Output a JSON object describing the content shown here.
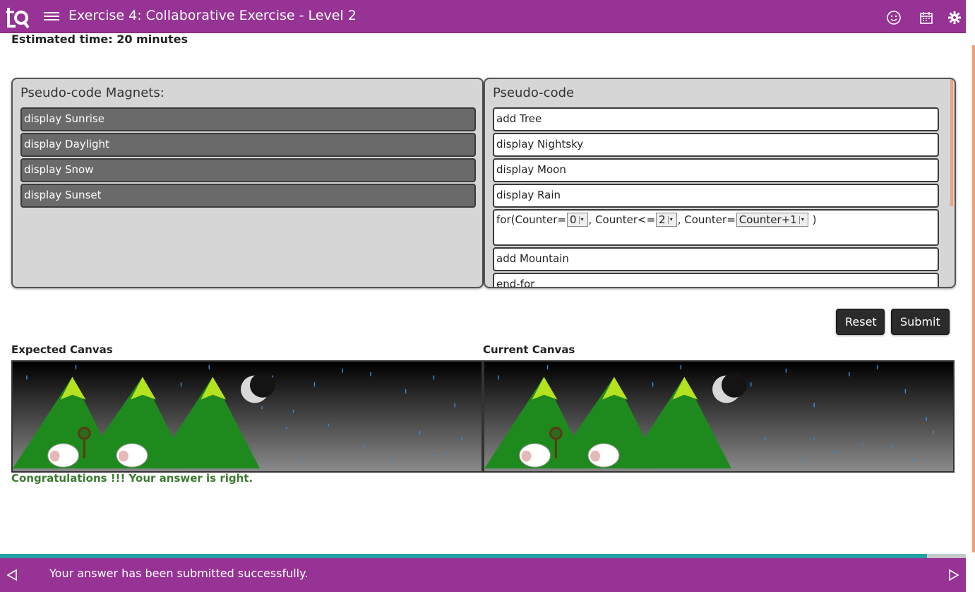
{
  "header": {
    "title": "Exercise 4: Collaborative Exercise - Level 2",
    "icons": [
      "logo-icon",
      "menu-icon",
      "smiley-icon",
      "calendar-icon",
      "gear-icon"
    ]
  },
  "estimate": "Estimated time: 20 minutes",
  "magnets": {
    "title": "Pseudo-code Magnets:",
    "items": [
      "display Sunrise",
      "display Daylight",
      "display Snow",
      "display Sunset"
    ]
  },
  "pseudocode": {
    "title": "Pseudo-code",
    "lines": [
      "add Tree",
      "display Nightsky",
      "display Moon",
      "display Rain"
    ],
    "loop": {
      "prefix": "for(Counter=",
      "start": "0",
      "mid": ", Counter<=",
      "end": "2",
      "mid2": ", Counter=",
      "step": "Counter+1",
      "suffix": " )"
    },
    "lines_after": [
      "add Mountain",
      "end-for"
    ]
  },
  "buttons": {
    "reset": "Reset",
    "submit": "Submit"
  },
  "canvases": {
    "expected_label": "Expected Canvas",
    "current_label": "Current Canvas"
  },
  "result": "Congratulations !!! Your answer is right.",
  "footer": {
    "status": "Your answer has been submitted successfully.",
    "progress": 0.96
  },
  "colors": {
    "brand": "#963394",
    "accent": "#23a0a4",
    "success": "#3c7a30"
  }
}
